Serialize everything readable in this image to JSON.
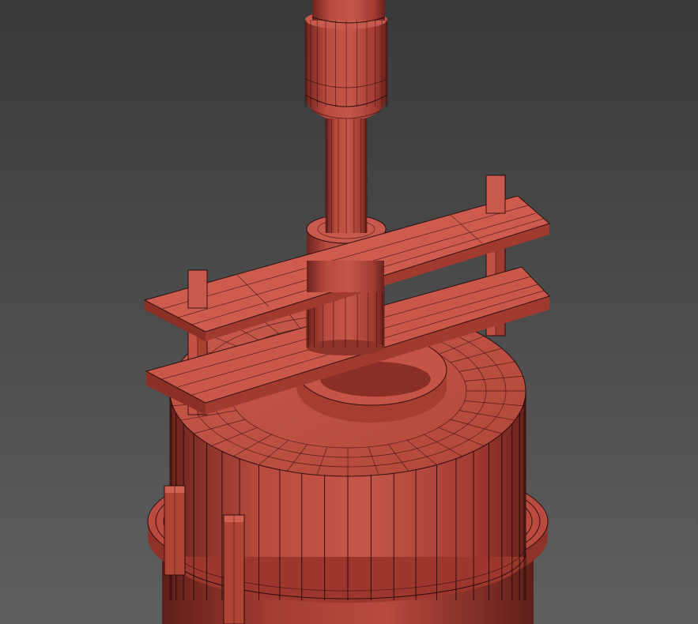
{
  "scene": {
    "subject": "wireframe-3d-model",
    "colors": {
      "background_top": "#3a3a3a",
      "background_bottom": "#5e5e5e",
      "mesh_base": "#b5453a",
      "mesh_light": "#c9564a",
      "mesh_dark": "#7a2a22",
      "mesh_shadow": "#5a1d18",
      "wire": "#1a0606"
    }
  }
}
